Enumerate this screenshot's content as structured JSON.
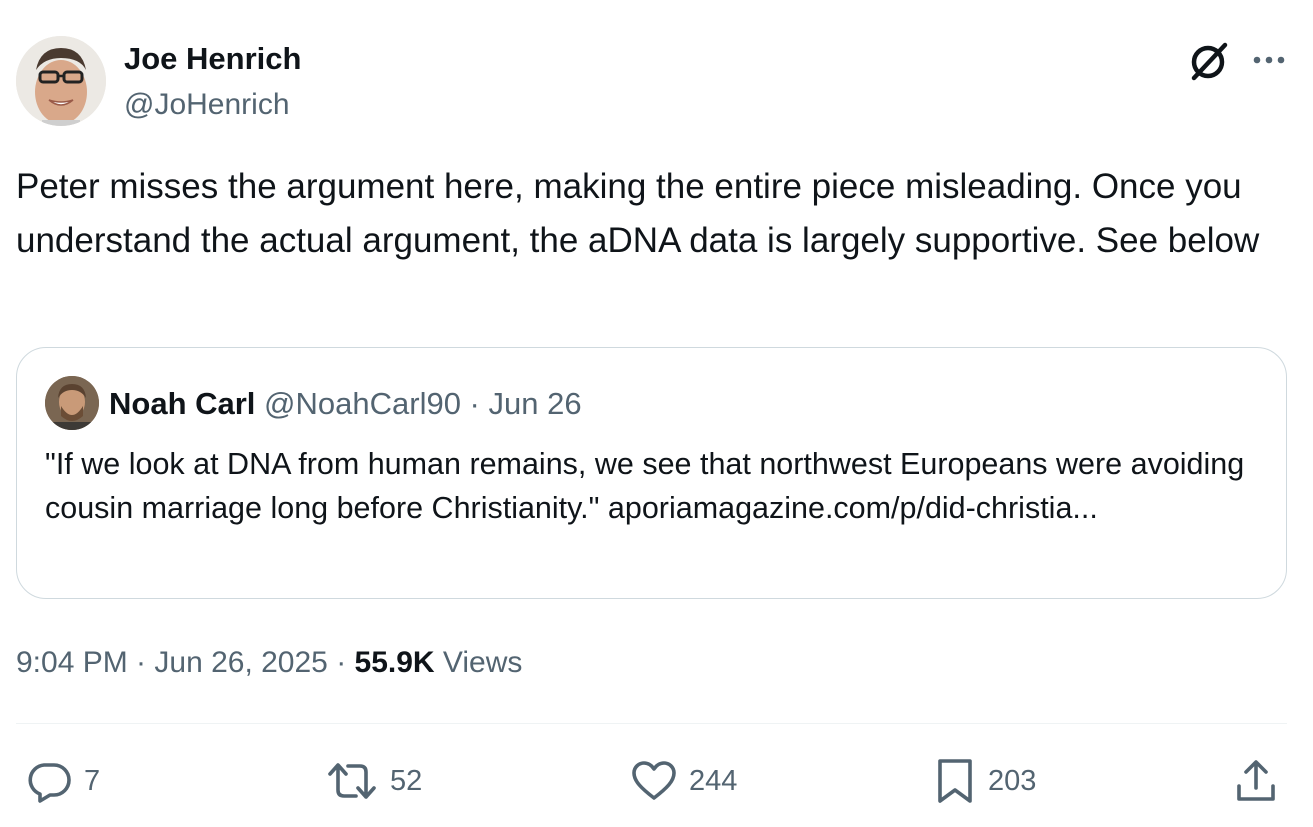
{
  "author": {
    "name": "Joe Henrich",
    "handle": "@JoHenrich"
  },
  "header_icons": {
    "grok": "grok-icon",
    "more": "more-icon"
  },
  "tweet_text": "Peter misses the argument here, making the entire piece misleading. Once you understand the actual argument, the aDNA data is largely supportive. See below",
  "quoted": {
    "name": "Noah Carl",
    "meta": "@NoahCarl90 · Jun 26",
    "text": "\"If we look at DNA from human remains, we see that northwest Europeans were avoiding cousin marriage long before Christianity.\" aporiamagazine.com/p/did-christia..."
  },
  "meta": {
    "time": "9:04 PM · Jun 26, 2025 · ",
    "views_count": "55.9K",
    "views_label": " Views"
  },
  "actions": {
    "replies": "7",
    "reposts": "52",
    "likes": "244",
    "bookmarks": "203"
  },
  "colors": {
    "text": "#0f1419",
    "secondary": "#536471",
    "border": "#cfd9de"
  }
}
